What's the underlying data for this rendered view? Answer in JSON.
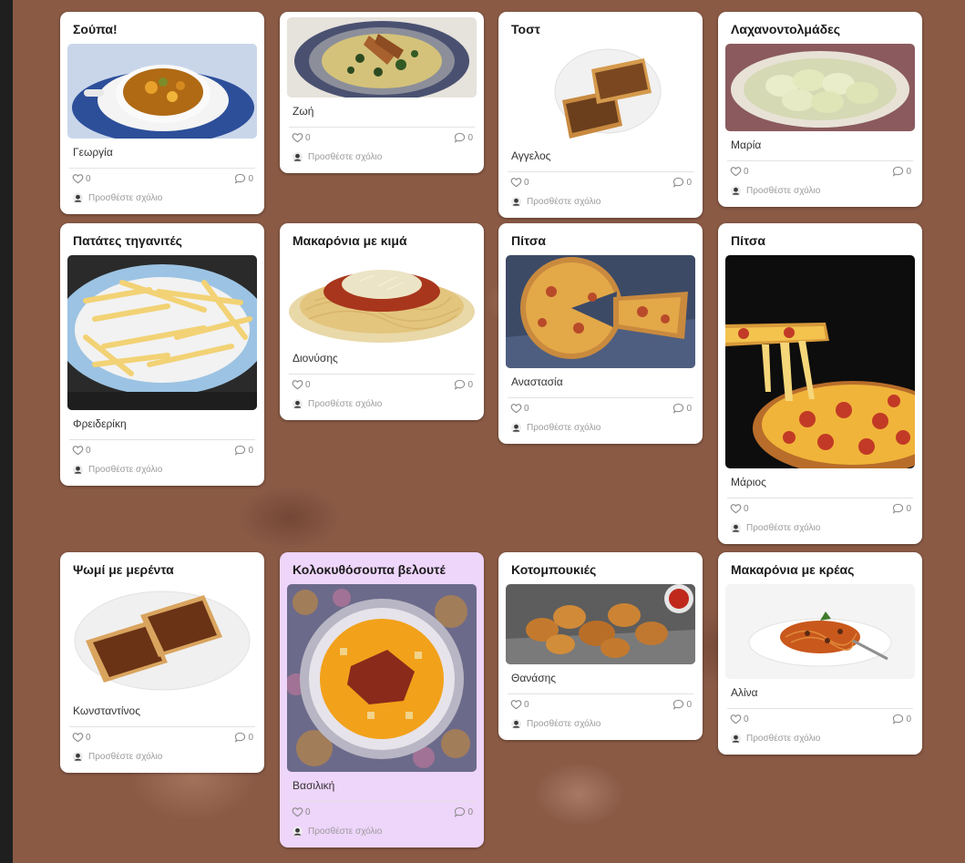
{
  "comment_placeholder": "Προσθέστε σχόλιο",
  "colors": {
    "highlight_card": "#eed5fa",
    "background": "#8a5a45"
  },
  "cards": [
    {
      "title": "Σούπα!",
      "author": "Γεωργία",
      "likes": "0",
      "comments": "0",
      "image": "soup-bowl"
    },
    {
      "title": "",
      "author": "Ζωή",
      "likes": "0",
      "comments": "0",
      "image": "meat-spinach-plate"
    },
    {
      "title": "Τοστ",
      "author": "Αγγελος",
      "likes": "0",
      "comments": "0",
      "image": "toast"
    },
    {
      "title": "Λαχανοντολμάδες",
      "author": "Μαρία",
      "likes": "0",
      "comments": "0",
      "image": "cabbage-rolls"
    },
    {
      "title": "Πατάτες τηγανιτές",
      "author": "Φρειδερίκη",
      "likes": "0",
      "comments": "0",
      "image": "french-fries"
    },
    {
      "title": "Μακαρόνια με κιμά",
      "author": "Διονύσης",
      "likes": "0",
      "comments": "0",
      "image": "spaghetti-bolognese"
    },
    {
      "title": "Πίτσα",
      "author": "Αναστασία",
      "likes": "0",
      "comments": "0",
      "image": "pizza-slice"
    },
    {
      "title": "Πίτσα",
      "author": "Μάριος",
      "likes": "0",
      "comments": "0",
      "image": "pepperoni-pizza"
    },
    {
      "title": "Ψωμί με μερέντα",
      "author": "Κωνσταντίνος",
      "likes": "0",
      "comments": "0",
      "image": "bread-chocolate"
    },
    {
      "title": "Κολοκυθόσουπα βελουτέ",
      "author": "Βασιλική",
      "likes": "0",
      "comments": "0",
      "image": "pumpkin-soup"
    },
    {
      "title": "Κοτομπουκιές",
      "author": "Θανάσης",
      "likes": "0",
      "comments": "0",
      "image": "chicken-nuggets"
    },
    {
      "title": "Μακαρόνια με κρέας",
      "author": "Αλίνα",
      "likes": "0",
      "comments": "0",
      "image": "pasta-meat"
    }
  ]
}
